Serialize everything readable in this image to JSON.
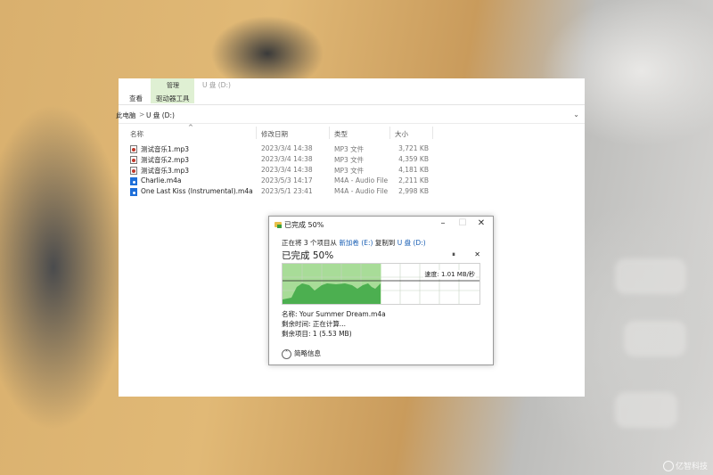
{
  "ribbon": {
    "context_label": "管理",
    "title": "U 盘 (D:)",
    "tabs": [
      "查看",
      "驱动器工具"
    ]
  },
  "address": {
    "root": "此电脑",
    "separator": ">",
    "current": "U 盘 (D:)"
  },
  "columns": {
    "name": "名称",
    "date": "修改日期",
    "type": "类型",
    "size": "大小"
  },
  "files": [
    {
      "name": "测试音乐1.mp3",
      "date": "2023/3/4 14:38",
      "type": "MP3 文件",
      "size": "3,721 KB",
      "icon": "mp3-file-icon"
    },
    {
      "name": "测试音乐2.mp3",
      "date": "2023/3/4 14:38",
      "type": "MP3 文件",
      "size": "4,359 KB",
      "icon": "mp3-file-icon"
    },
    {
      "name": "测试音乐3.mp3",
      "date": "2023/3/4 14:38",
      "type": "MP3 文件",
      "size": "4,181 KB",
      "icon": "mp3-file-icon"
    },
    {
      "name": "Charlie.m4a",
      "date": "2023/5/3 14:17",
      "type": "M4A - Audio File",
      "size": "2,211 KB",
      "icon": "m4a-file-icon"
    },
    {
      "name": "One Last Kiss (Instrumental).m4a",
      "date": "2023/5/1 23:41",
      "type": "M4A - Audio File",
      "size": "2,998 KB",
      "icon": "m4a-file-icon"
    }
  ],
  "dialog": {
    "title": "已完成 50%",
    "line_prefix": "正在将 3 个项目从 ",
    "source": "新加卷 (E:)",
    "line_mid": " 复制到 ",
    "dest": "U 盘 (D:)",
    "progress_text": "已完成 50%",
    "progress_fraction": 0.5,
    "speed": "速度: 1.01 MB/秒",
    "name_line": "名称: Your Summer Dream.m4a",
    "time_line": "剩余时间: 正在计算...",
    "items_line": "剩余项目: 1 (5.53 MB)",
    "less_details": "简略信息",
    "pause_glyph": "⏸",
    "cancel_glyph": "✕",
    "colors": {
      "progress_fill": "#a8dc98",
      "throughput": "#4caf50"
    }
  },
  "watermark": "亿智科技"
}
